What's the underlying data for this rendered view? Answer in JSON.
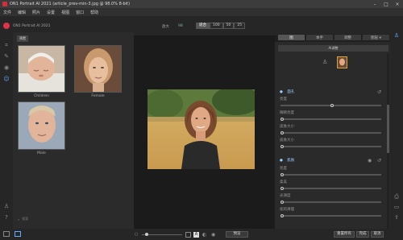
{
  "window": {
    "title": "ON1 Portrait AI 2021 (article_prev-min-3.jpg @ 98.0% 8-bit)"
  },
  "menu": [
    "文件",
    "编辑",
    "照片",
    "设置",
    "视图",
    "窗口",
    "帮助"
  ],
  "header": {
    "module_title": "ON1 Portrait AI 2021",
    "zoom_label": "放大",
    "zoom_value": "98",
    "zoom_buttons": [
      "适合",
      "100",
      "50",
      "25"
    ]
  },
  "right_tabs": [
    "图",
    "本手",
    "调整",
    "图层 ▾"
  ],
  "browser": {
    "tab": "预置",
    "items": [
      {
        "label": "Children"
      },
      {
        "label": "Female"
      },
      {
        "label": "Male"
      }
    ],
    "search_placeholder": "搜索"
  },
  "panel": {
    "ai_button": "AI调整",
    "sec_face": "面孔",
    "sec_face_labels": [
      "亮度",
      "眼睛亮度",
      "皮肤大小",
      "皮肤大小"
    ],
    "sec_skin": "肌肤",
    "sec_skin_labels": [
      "亮度",
      "柔美",
      "光滑度",
      "痣的清理"
    ]
  },
  "bottom": {
    "preview_label": "预览",
    "reset_all": "重置所有",
    "done": "完成",
    "cancel": "取消"
  },
  "colors": {
    "accent": "#d42e3c",
    "section": "#8ac4ff"
  }
}
